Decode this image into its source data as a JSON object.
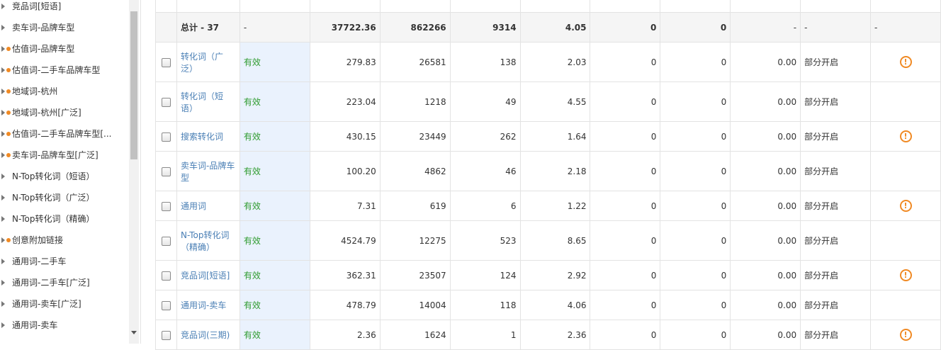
{
  "tree": {
    "items": [
      {
        "label": "竞品词[短语]",
        "dot": false
      },
      {
        "label": "卖车词-品牌车型",
        "dot": false
      },
      {
        "label": "估值词-品牌车型",
        "dot": true
      },
      {
        "label": "估值词-二手车品牌车型",
        "dot": true
      },
      {
        "label": "地域词-杭州",
        "dot": true
      },
      {
        "label": "地域词-杭州[广泛]",
        "dot": true
      },
      {
        "label": "估值词-二手车品牌车型[...",
        "dot": true
      },
      {
        "label": "卖车词-品牌车型[广泛]",
        "dot": true
      },
      {
        "label": "N-Top转化词（短语）",
        "dot": false
      },
      {
        "label": "N-Top转化词（广泛）",
        "dot": false
      },
      {
        "label": "N-Top转化词（精确）",
        "dot": false
      },
      {
        "label": "创意附加链接",
        "dot": true
      },
      {
        "label": "通用词-二手车",
        "dot": false
      },
      {
        "label": "通用词-二手车[广泛]",
        "dot": false
      },
      {
        "label": "通用词-卖车[广泛]",
        "dot": false
      },
      {
        "label": "通用词-卖车",
        "dot": false
      }
    ]
  },
  "table": {
    "total": {
      "label": "总计 - 37",
      "status": "-",
      "v1": "37722.36",
      "v2": "862266",
      "v3": "9314",
      "v4": "4.05",
      "v5": "0",
      "v6": "0",
      "v7": "-",
      "v8": "-",
      "v9": "-"
    },
    "rows": [
      {
        "name": "转化词（广泛）",
        "status": "有效",
        "v1": "279.83",
        "v2": "26581",
        "v3": "138",
        "v4": "2.03",
        "v5": "0",
        "v6": "0",
        "v7": "0.00",
        "v8": "部分开启",
        "warn": true,
        "h": 56
      },
      {
        "name": "转化词（短语）",
        "status": "有效",
        "v1": "223.04",
        "v2": "1218",
        "v3": "49",
        "v4": "4.55",
        "v5": "0",
        "v6": "0",
        "v7": "0.00",
        "v8": "部分开启",
        "warn": false,
        "h": 56
      },
      {
        "name": "搜索转化词",
        "status": "有效",
        "v1": "430.15",
        "v2": "23449",
        "v3": "262",
        "v4": "1.64",
        "v5": "0",
        "v6": "0",
        "v7": "0.00",
        "v8": "部分开启",
        "warn": true,
        "h": 42
      },
      {
        "name": "卖车词-品牌车型",
        "status": "有效",
        "v1": "100.20",
        "v2": "4862",
        "v3": "46",
        "v4": "2.18",
        "v5": "0",
        "v6": "0",
        "v7": "0.00",
        "v8": "部分开启",
        "warn": false,
        "h": 56
      },
      {
        "name": "通用词",
        "status": "有效",
        "v1": "7.31",
        "v2": "619",
        "v3": "6",
        "v4": "1.22",
        "v5": "0",
        "v6": "0",
        "v7": "0.00",
        "v8": "部分开启",
        "warn": true,
        "h": 42
      },
      {
        "name": "N-Top转化词（精确）",
        "status": "有效",
        "v1": "4524.79",
        "v2": "12275",
        "v3": "523",
        "v4": "8.65",
        "v5": "0",
        "v6": "0",
        "v7": "0.00",
        "v8": "部分开启",
        "warn": false,
        "h": 56
      },
      {
        "name": "竞品词[短语]",
        "status": "有效",
        "v1": "362.31",
        "v2": "23507",
        "v3": "124",
        "v4": "2.92",
        "v5": "0",
        "v6": "0",
        "v7": "0.00",
        "v8": "部分开启",
        "warn": true,
        "h": 42
      },
      {
        "name": "通用词-卖车",
        "status": "有效",
        "v1": "478.79",
        "v2": "14004",
        "v3": "118",
        "v4": "4.06",
        "v5": "0",
        "v6": "0",
        "v7": "0.00",
        "v8": "部分开启",
        "warn": false,
        "h": 42
      },
      {
        "name": "竞品词(三期)",
        "status": "有效",
        "v1": "2.36",
        "v2": "1624",
        "v3": "1",
        "v4": "2.36",
        "v5": "0",
        "v6": "0",
        "v7": "0.00",
        "v8": "部分开启",
        "warn": true,
        "h": 42
      }
    ]
  },
  "icons": {
    "warning": "warning-circle-icon",
    "checkbox": "checkbox-icon"
  },
  "colors": {
    "link": "#4a7fb5",
    "status": "#2e9b2e",
    "warning": "#f08a24"
  }
}
